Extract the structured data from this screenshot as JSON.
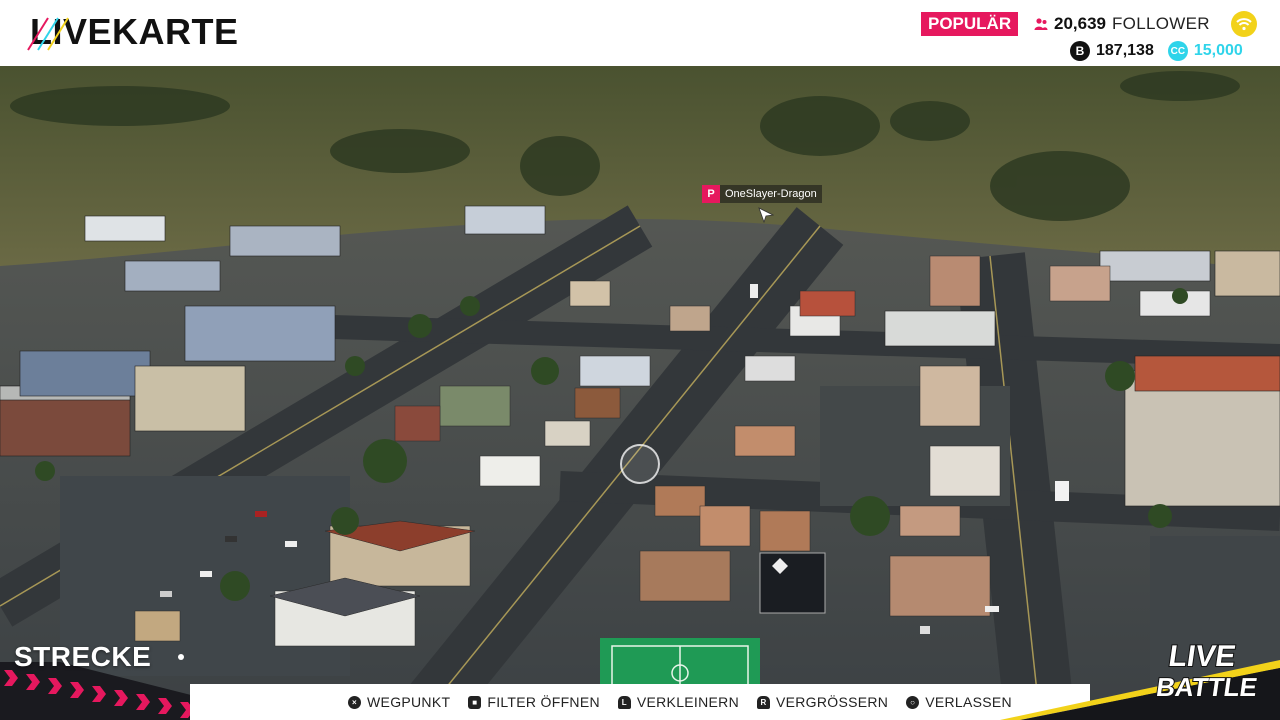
{
  "header": {
    "logo_text": "LIVEKARTE",
    "popular_label": "POPULÄR",
    "follower_count": "20,639",
    "follower_label": "FOLLOWER",
    "money_value": "187,138",
    "cc_value": "15,000",
    "cc_icon_label": "CC",
    "coin_icon_label": "B"
  },
  "map": {
    "player_badge": "P",
    "player_name": "OneSlayer-Dragon"
  },
  "hud": {
    "section_label": "STRECKE"
  },
  "controls": [
    {
      "button": "×",
      "label": "WEGPUNKT",
      "icon": "cross-button-icon"
    },
    {
      "button": "■",
      "label": "FILTER ÖFFNEN",
      "icon": "square-button-icon"
    },
    {
      "button": "L",
      "label": "VERKLEINERN",
      "icon": "l2-trigger-icon"
    },
    {
      "button": "R",
      "label": "VERGRÖSSERN",
      "icon": "r2-trigger-icon"
    },
    {
      "button": "○",
      "label": "VERLASSEN",
      "icon": "circle-button-icon"
    }
  ],
  "brand": {
    "line1": "LIVE",
    "line2": "BATTLE"
  },
  "colors": {
    "accent_pink": "#e6185e",
    "cc_cyan": "#2fd4ea",
    "wifi_yellow": "#f2d21a"
  }
}
